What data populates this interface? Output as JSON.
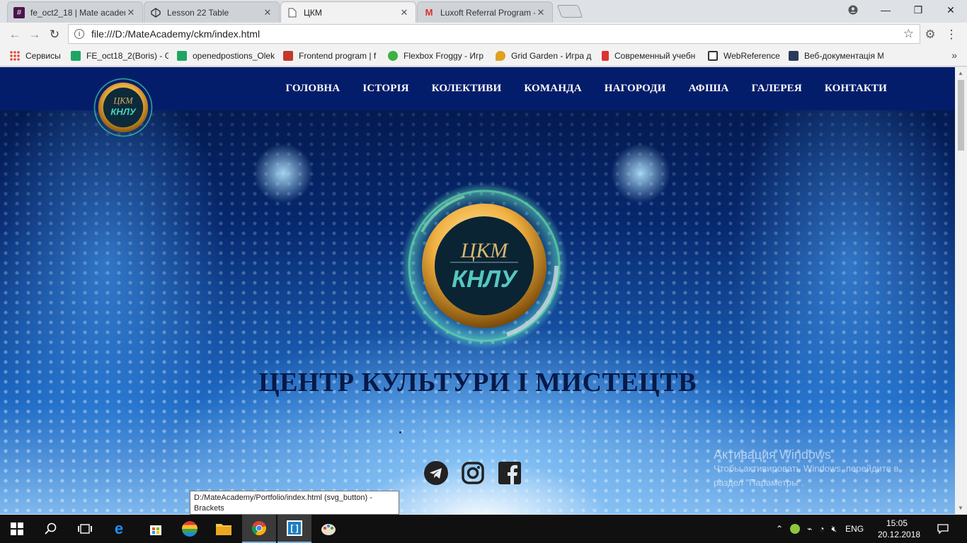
{
  "browser": {
    "tabs": [
      {
        "title": "fe_oct2_18 | Mate academ",
        "icon": "slack-hash-icon"
      },
      {
        "title": "Lesson 22 Table",
        "icon": "codepen-icon"
      },
      {
        "title": "ЦКМ",
        "icon": "page-icon"
      },
      {
        "title": "Luxoft Referral Program -",
        "icon": "gmail-icon"
      }
    ],
    "url": "file:///D:/MateAcademy/ckm/index.html",
    "bookmarks": [
      {
        "label": "Сервисы",
        "icon": "apps-grid-icon"
      },
      {
        "label": "FE_oct18_2(Boris) - G",
        "icon": "sheets-icon"
      },
      {
        "label": "openedpostions_Olek",
        "icon": "sheets-icon"
      },
      {
        "label": "Frontend program | f",
        "icon": "mo-icon"
      },
      {
        "label": "Flexbox Froggy - Игр",
        "icon": "frog-icon"
      },
      {
        "label": "Grid Garden - Игра д",
        "icon": "carrot-icon"
      },
      {
        "label": "Современный учебн",
        "icon": "js-icon"
      },
      {
        "label": "WebReference",
        "icon": "chat-icon"
      },
      {
        "label": "Веб-документація M",
        "icon": "mdn-icon"
      }
    ]
  },
  "site": {
    "logo_text_top": "ЦКМ",
    "logo_text_bottom": "КНЛУ",
    "nav": [
      "ГОЛОВНА",
      "ІСТОРІЯ",
      "КОЛЕКТИВИ",
      "КОМАНДА",
      "НАГОРОДИ",
      "АФІША",
      "ГАЛЕРЕЯ",
      "КОНТАКТИ"
    ],
    "hero_title": "ЦЕНТР КУЛЬТУРИ І МИСТЕЦТВ",
    "socials": [
      "telegram-icon",
      "instagram-icon",
      "facebook-icon"
    ]
  },
  "overlay": {
    "activation_title": "Активация Windows",
    "activation_line1": "Чтобы активировать Windows, перейдите в",
    "activation_line2": "раздел \"Параметры\".",
    "tooltip_line1": "D:/MateAcademy/Portfolio/index.html (svg_button) -",
    "tooltip_line2": "Brackets"
  },
  "taskbar": {
    "language": "ENG",
    "time": "15:05",
    "date": "20.12.2018"
  },
  "colors": {
    "header_bg": "#041d6b",
    "title_color": "#071a49",
    "gold": "#e8a93a"
  }
}
